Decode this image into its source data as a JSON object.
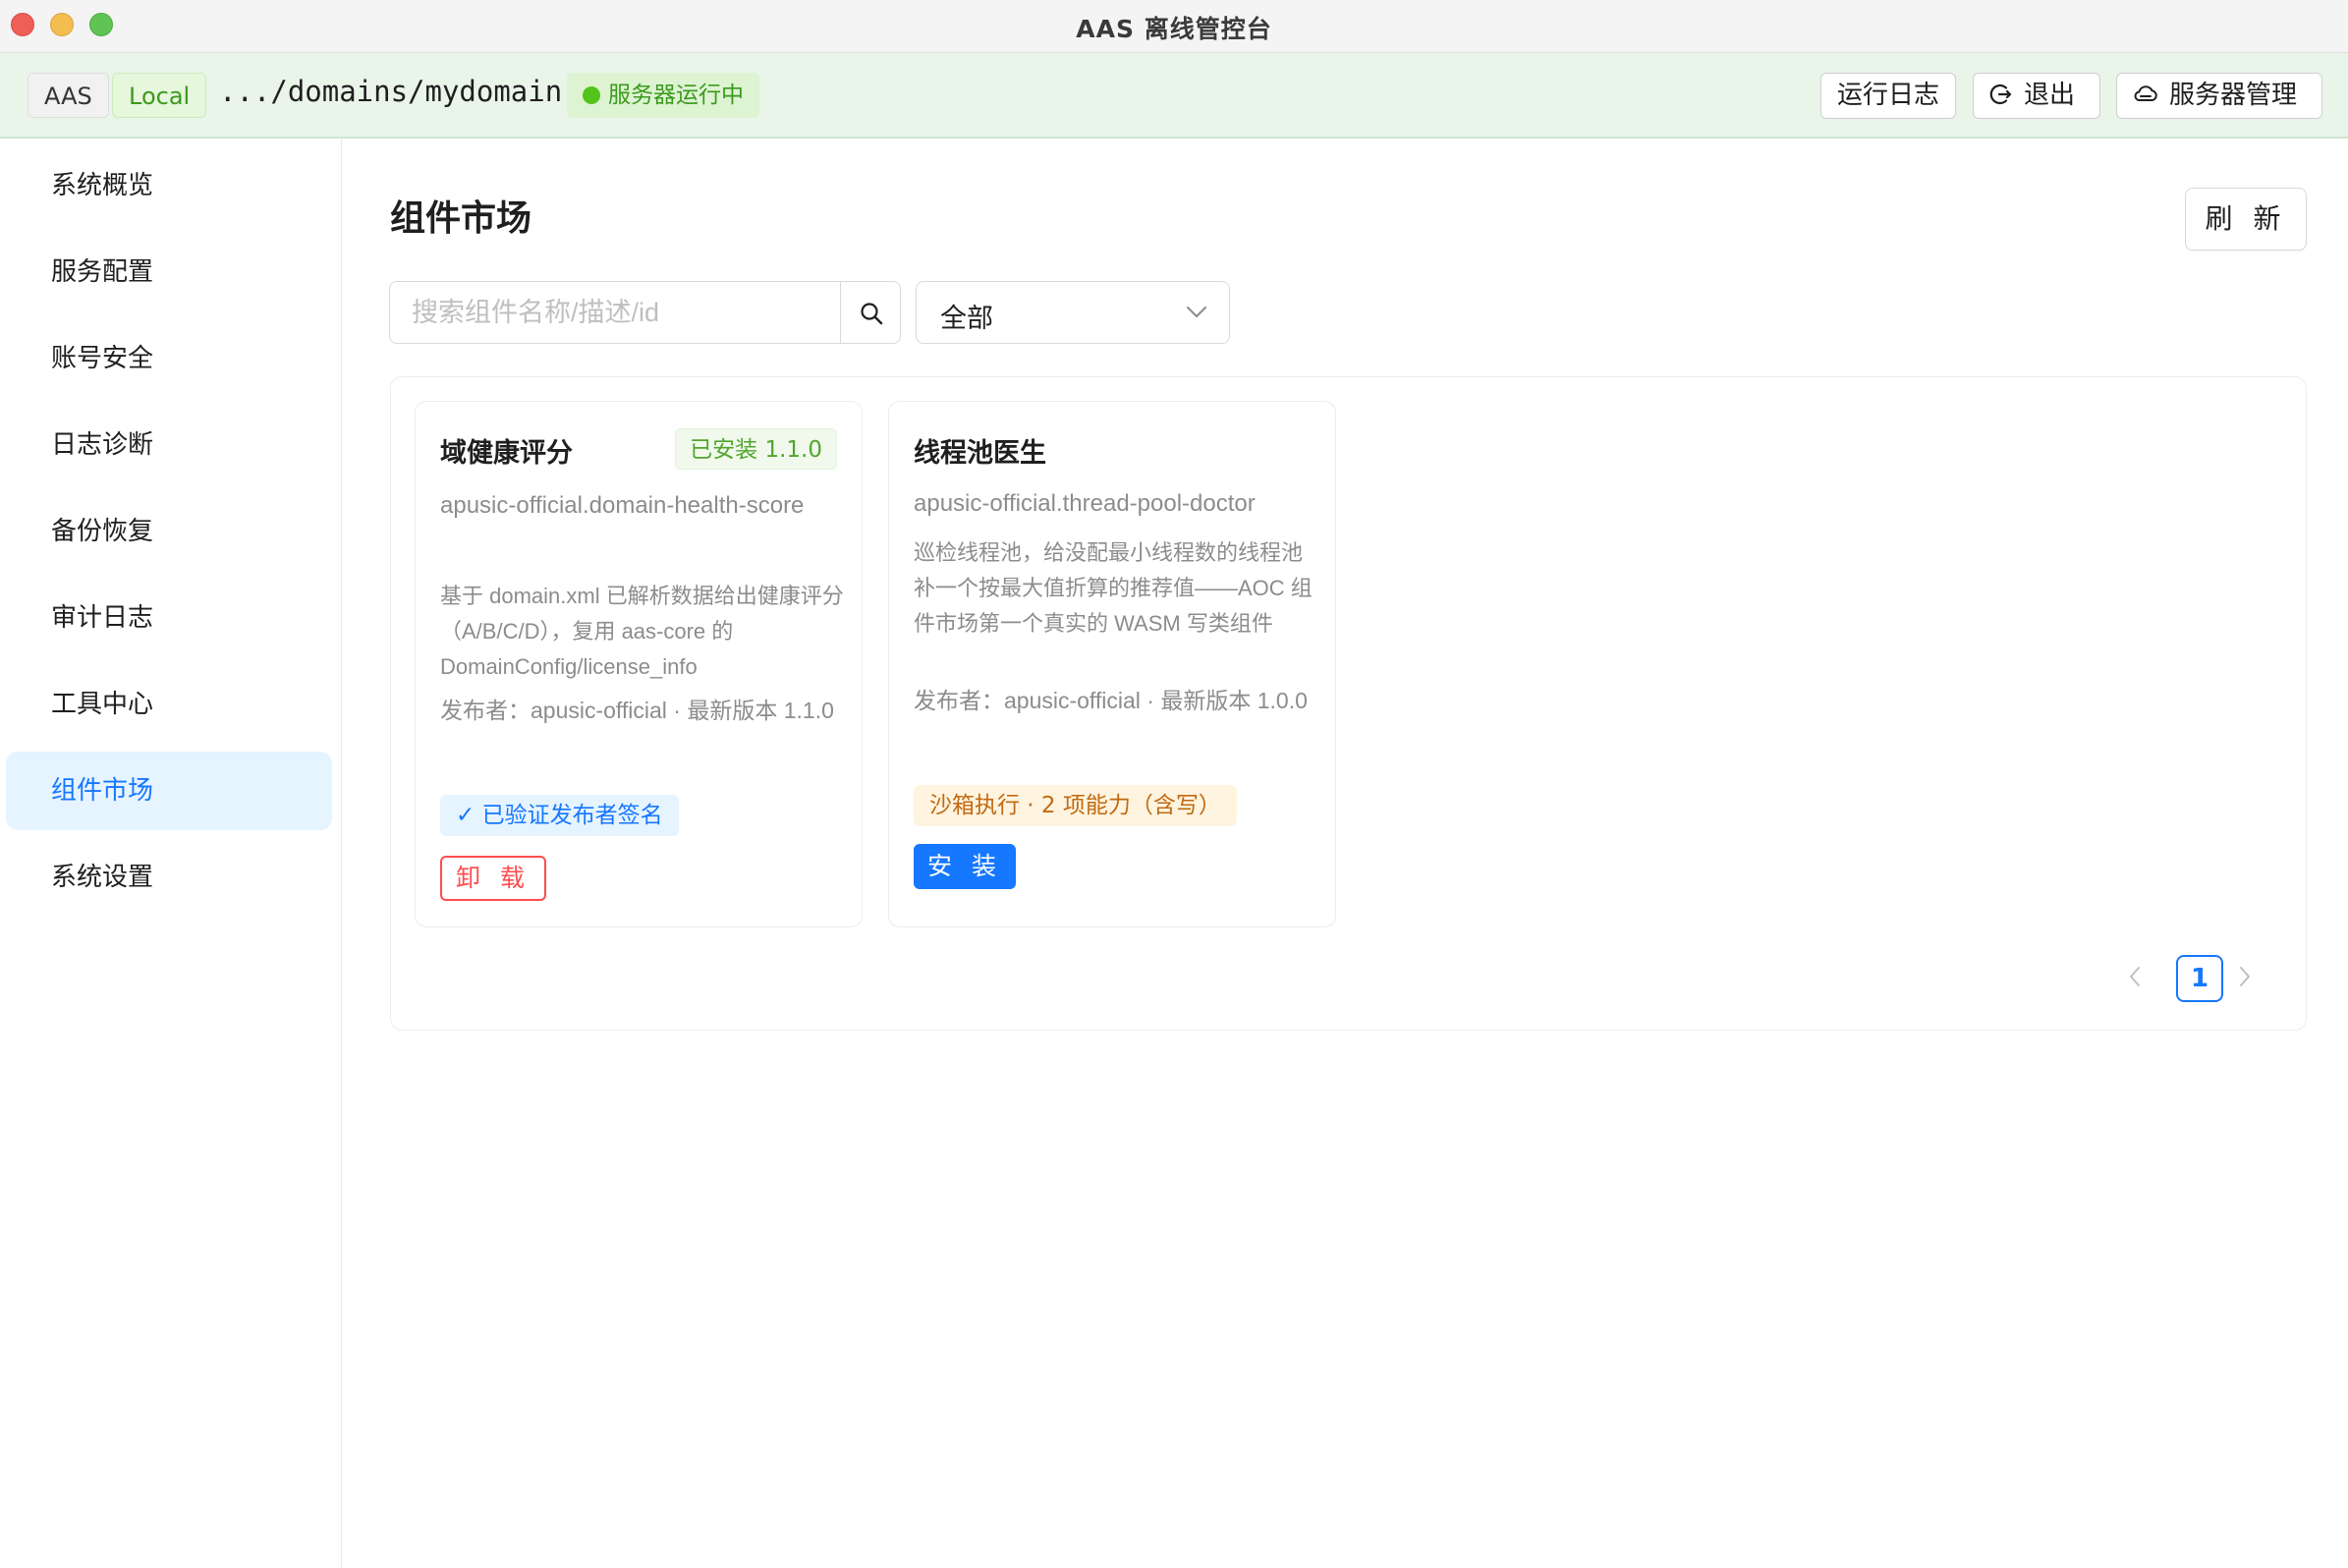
{
  "window": {
    "title": "AAS 离线管控台"
  },
  "topbar": {
    "tag_aas": "AAS",
    "tag_local": "Local",
    "domain_path": ".../domains/mydomain",
    "status": "服务器运行中",
    "buttons": {
      "log": "运行日志",
      "exit": "退出",
      "server": "服务器管理"
    }
  },
  "sidebar": {
    "items": [
      {
        "label": "系统概览"
      },
      {
        "label": "服务配置"
      },
      {
        "label": "账号安全"
      },
      {
        "label": "日志诊断"
      },
      {
        "label": "备份恢复"
      },
      {
        "label": "审计日志"
      },
      {
        "label": "工具中心"
      },
      {
        "label": "组件市场"
      },
      {
        "label": "系统设置"
      }
    ],
    "active_index": 7
  },
  "main": {
    "title": "组件市场",
    "refresh_label": "刷 新",
    "search": {
      "placeholder": "搜索组件名称/描述/id",
      "value": ""
    },
    "filter": {
      "selected": "全部"
    }
  },
  "cards": [
    {
      "title": "域健康评分",
      "installed_badge": "已安装 1.1.0",
      "id": "apusic-official.domain-health-score",
      "description": "基于 domain.xml 已解析数据给出健康评分（A/B/C/D），复用 aas-core 的 DomainConfig/license_info",
      "publisher": "发布者：apusic-official · 最新版本 1.1.0",
      "verified": "✓ 已验证发布者签名",
      "action": "卸 载"
    },
    {
      "title": "线程池医生",
      "id": "apusic-official.thread-pool-doctor",
      "description": "巡检线程池，给没配最小线程数的线程池补一个按最大值折算的推荐值——AOC 组件市场第一个真实的 WASM 写类组件",
      "publisher": "发布者：apusic-official · 最新版本 1.0.0",
      "sandbox": "沙箱执行 · 2 项能力（含写）",
      "action": "安 装"
    }
  ],
  "pagination": {
    "current": "1"
  },
  "colors": {
    "accent": "#1677ff",
    "success": "#52c41a",
    "danger": "#ff4d4f",
    "warning": "#c26a12"
  }
}
